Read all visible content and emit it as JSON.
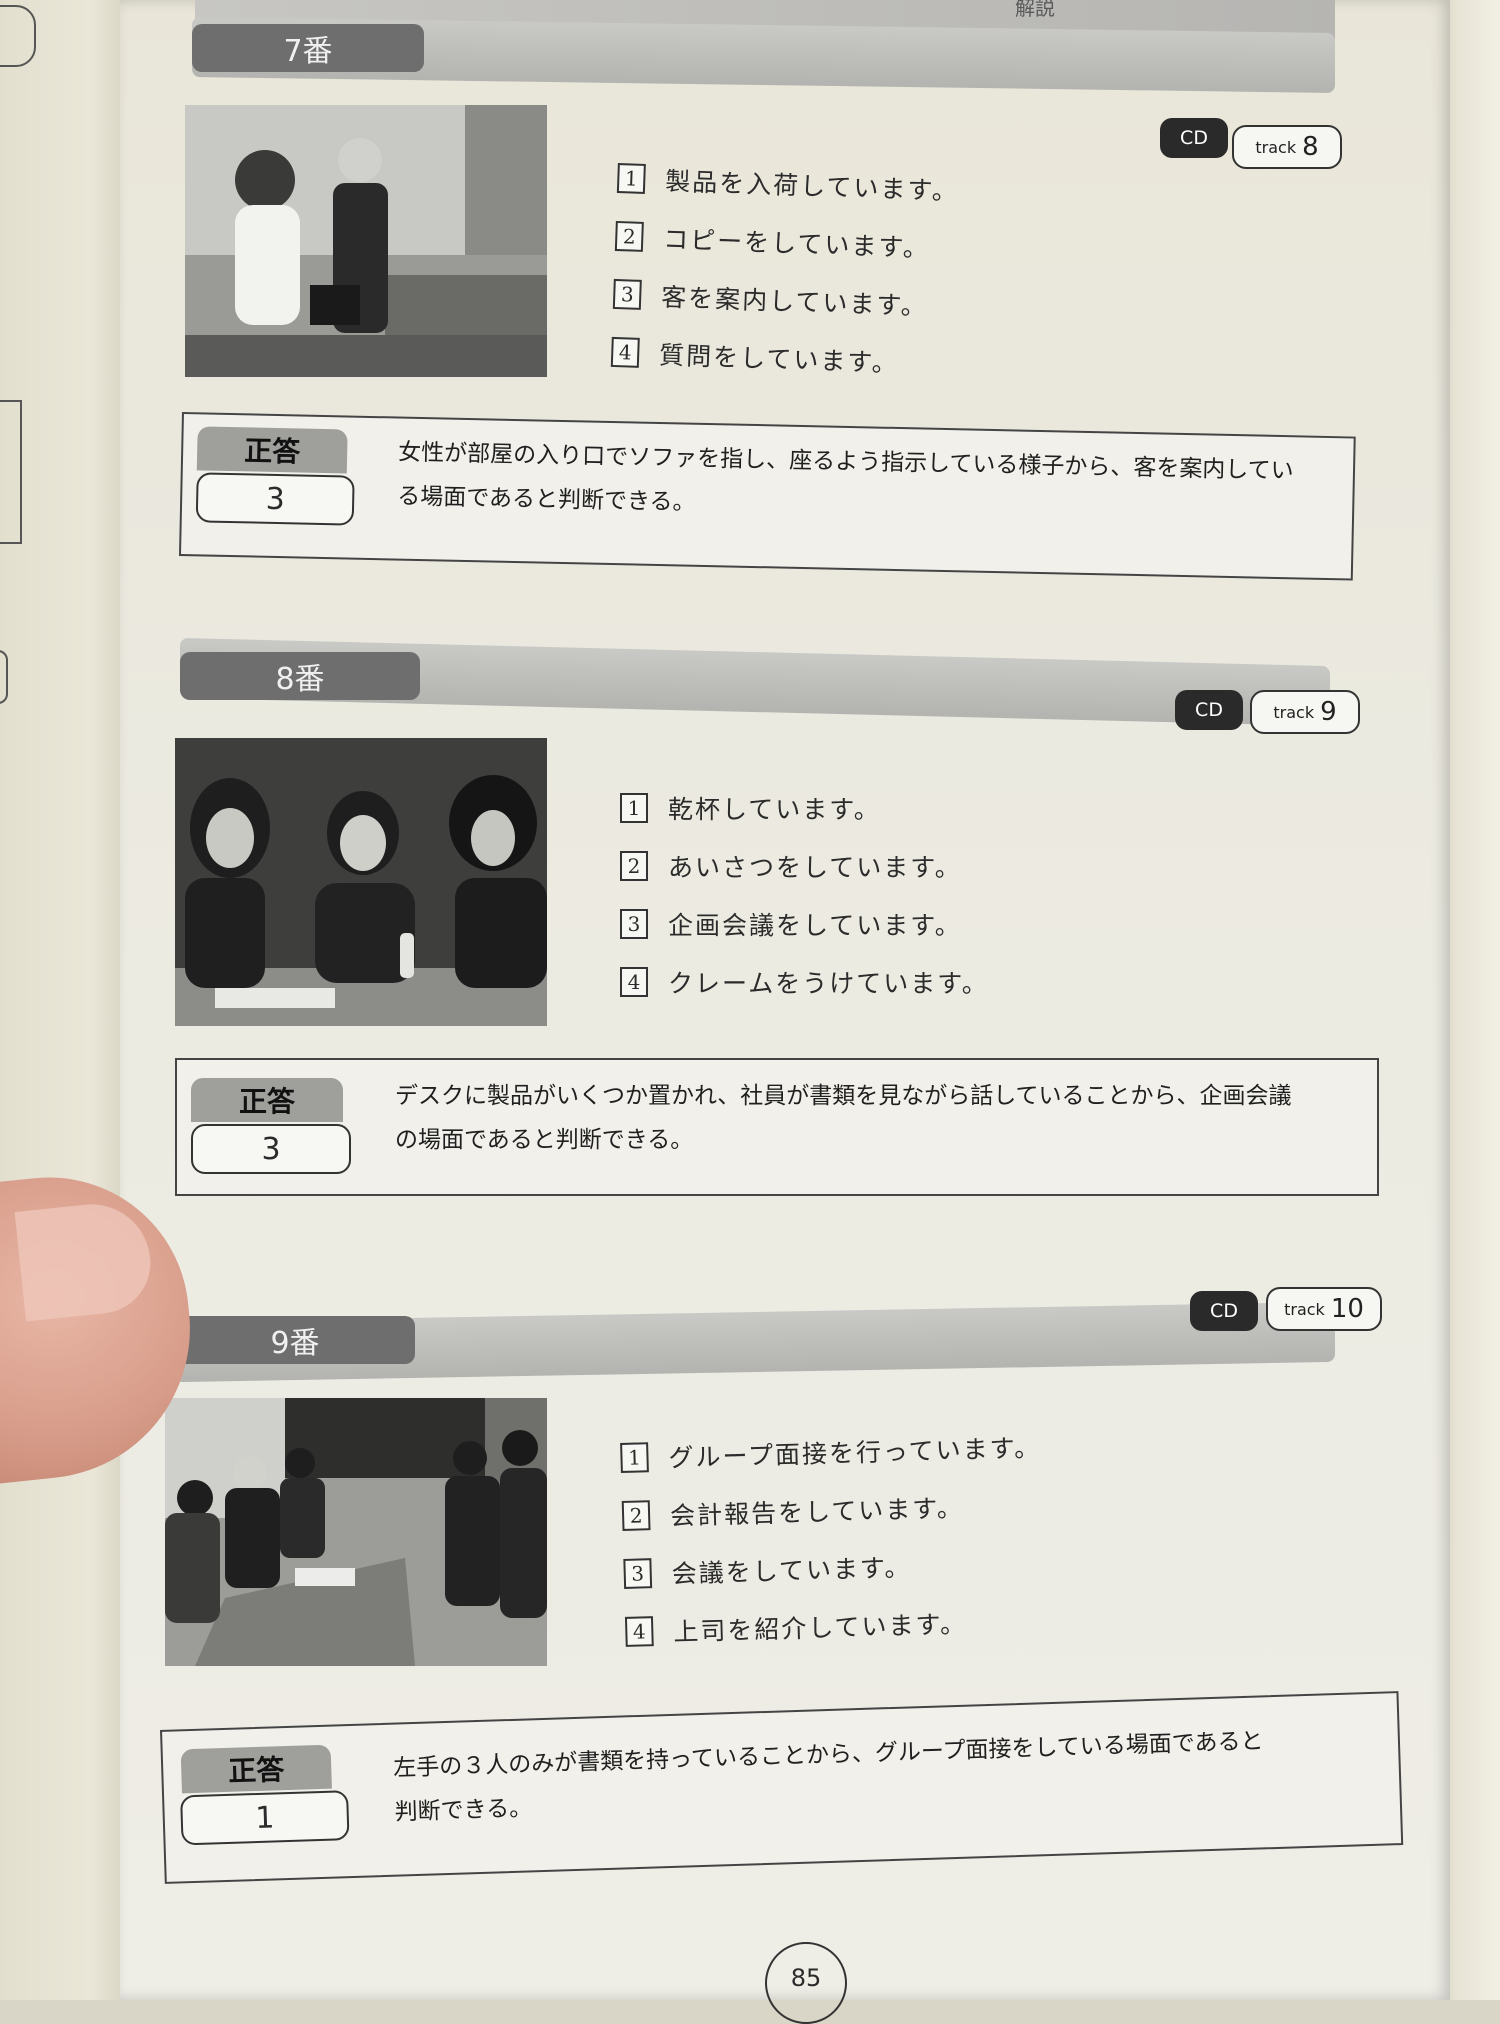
{
  "header": {
    "text": "解説"
  },
  "sections": [
    {
      "number": "7番",
      "cd": "CD",
      "track_word": "track",
      "track_number": "8",
      "choices": [
        {
          "n": "1",
          "text": "製品を入荷しています。"
        },
        {
          "n": "2",
          "text": "コピーをしています。"
        },
        {
          "n": "3",
          "text": "客を案内しています。"
        },
        {
          "n": "4",
          "text": "質問をしています。"
        }
      ],
      "answer_label": "正答",
      "answer_value": "3",
      "explanation_line1": "女性が部屋の入り口でソファを指し、座るよう指示している様子から、客を案内してい",
      "explanation_line2": "る場面であると判断できる。"
    },
    {
      "number": "8番",
      "cd": "CD",
      "track_word": "track",
      "track_number": "9",
      "choices": [
        {
          "n": "1",
          "text": "乾杯しています。"
        },
        {
          "n": "2",
          "text": "あいさつをしています。"
        },
        {
          "n": "3",
          "text": "企画会議をしています。"
        },
        {
          "n": "4",
          "text": "クレームをうけています。"
        }
      ],
      "answer_label": "正答",
      "answer_value": "3",
      "explanation_line1": "デスクに製品がいくつか置かれ、社員が書類を見ながら話していることから、企画会議",
      "explanation_line2": "の場面であると判断できる。"
    },
    {
      "number": "9番",
      "cd": "CD",
      "track_word": "track",
      "track_number": "10",
      "choices": [
        {
          "n": "1",
          "text": "グループ面接を行っています。"
        },
        {
          "n": "2",
          "text": "会計報告をしています。"
        },
        {
          "n": "3",
          "text": "会議をしています。"
        },
        {
          "n": "4",
          "text": "上司を紹介しています。"
        }
      ],
      "answer_label": "正答",
      "answer_value": "1",
      "explanation_line1": "左手の３人のみが書類を持っていることから、グループ面接をしている場面であると",
      "explanation_line2": "判断できる。"
    }
  ],
  "page_number": "85"
}
